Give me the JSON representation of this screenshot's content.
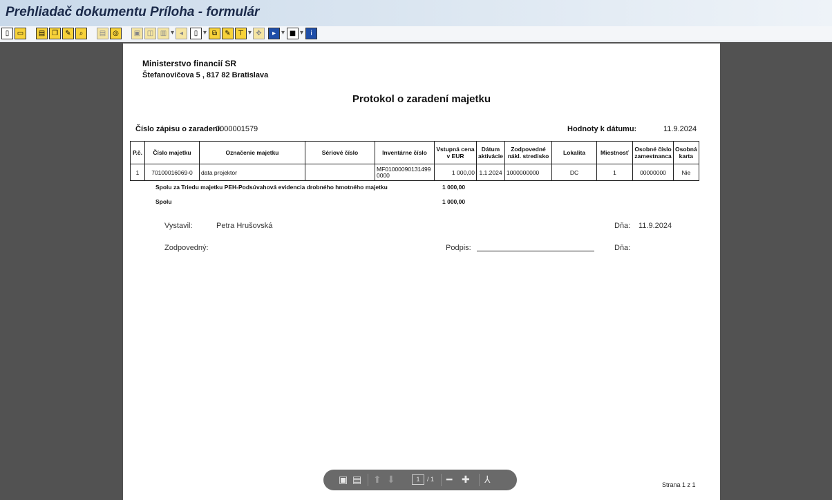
{
  "window": {
    "title": "Prehliadač dokumentu Príloha - formulár"
  },
  "toolbar": {
    "buttons": [
      {
        "icon": "new-document-icon"
      },
      {
        "icon": "open-folder-icon"
      },
      {
        "icon": "print-icon"
      },
      {
        "icon": "copy-icon"
      },
      {
        "icon": "edit-icon"
      },
      {
        "icon": "find-icon"
      },
      {
        "icon": "print-preview-icon"
      },
      {
        "icon": "page-setup-icon"
      },
      {
        "icon": "save-icon"
      },
      {
        "icon": "view-icon"
      },
      {
        "icon": "layout-icon"
      },
      {
        "icon": "pointer-icon"
      },
      {
        "icon": "page-icon"
      },
      {
        "icon": "export-icon"
      },
      {
        "icon": "filter-icon"
      },
      {
        "icon": "table-icon"
      },
      {
        "icon": "navigate-icon"
      },
      {
        "icon": "play-icon"
      },
      {
        "icon": "stop-icon"
      },
      {
        "icon": "info-icon"
      }
    ]
  },
  "document": {
    "ministry": "Ministerstvo financií SR",
    "address": "Štefanovičova 5 , 817 82 Bratislava",
    "title": "Protokol o zaradení majetku",
    "registration_label": "Číslo zápisu o zaradení:",
    "registration_value": "0000001579",
    "date_label": "Hodnoty k dátumu:",
    "date_value": "11.9.2024",
    "table": {
      "headers": [
        "P.č.",
        "Číslo majetku",
        "Označenie majetku",
        "Sériové číslo",
        "Inventárne číslo",
        "Vstupná cena v EUR",
        "Dátum aktivácie",
        "Zodpovedné nákl. stredisko",
        "Lokalita",
        "Miestnosť",
        "Osobné číslo zamestnanca",
        "Osobná karta"
      ],
      "rows": [
        [
          "1",
          "70100016069-0",
          "data projektor",
          "",
          "MF01000090131499 0000",
          "1 000,00",
          "1.1.2024",
          "1000000000",
          "DC",
          "1",
          "00000000",
          "Nie"
        ]
      ]
    },
    "subtotal_label": "Spolu za Triedu majetku   PEH-Podsúvahová evidencia drobného hmotného majetku",
    "subtotal_value": "1 000,00",
    "total_label": "Spolu",
    "total_value": "1 000,00",
    "issued_by_label": "Vystavil:",
    "issued_by_value": "Petra Hrušovská",
    "day_label": "Dňa:",
    "day_value": "11.9.2024",
    "responsible_label": "Zodpovedný:",
    "signature_label": "Podpis:",
    "day_label_2": "Dňa:",
    "page_footer": "Strana  1 z 1"
  },
  "pager": {
    "current_page": "1",
    "total_pages": "/ 1"
  }
}
